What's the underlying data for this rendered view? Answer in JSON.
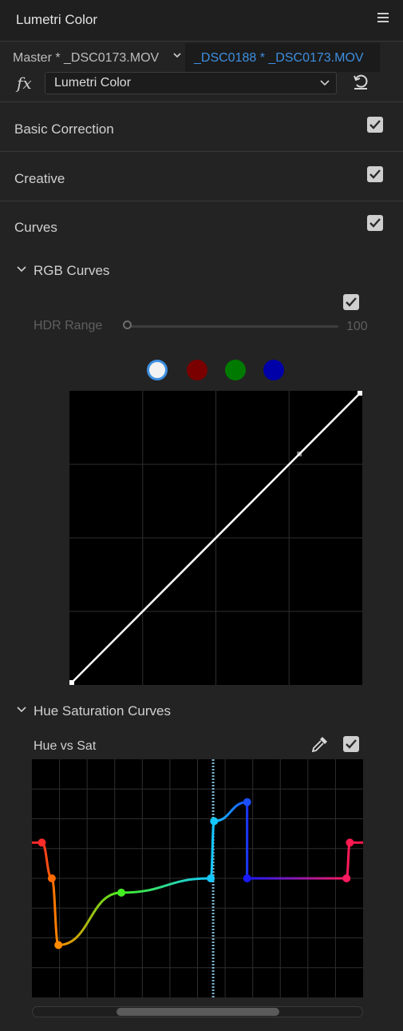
{
  "panel": {
    "title": "Lumetri Color"
  },
  "clip_bar": {
    "master_label": "Master * _DSC0173.MOV",
    "active_clip_label": "_DSC0188 * _DSC0173.MOV"
  },
  "effect": {
    "fx_symbol": "fx",
    "selected": "Lumetri Color"
  },
  "sections": {
    "basic_correction": {
      "label": "Basic Correction",
      "checked": true
    },
    "creative": {
      "label": "Creative",
      "checked": true
    },
    "curves": {
      "label": "Curves",
      "checked": true
    }
  },
  "rgb_curves": {
    "label": "RGB Curves",
    "enabled": true,
    "hdr_range": {
      "label": "HDR Range",
      "value": "100",
      "level": 0
    },
    "channels": [
      {
        "name": "white",
        "color": "#f2f2f2",
        "selected": true
      },
      {
        "name": "red",
        "color": "#7a0000",
        "selected": false
      },
      {
        "name": "green",
        "color": "#007a00",
        "selected": false
      },
      {
        "name": "blue",
        "color": "#0000a8",
        "selected": false
      }
    ],
    "curve_points": [
      [
        0,
        0
      ],
      [
        0.79,
        0.79
      ],
      [
        1,
        1
      ]
    ]
  },
  "hue_saturation_curves": {
    "label": "Hue Saturation Curves",
    "hue_vs_sat": {
      "label": "Hue vs Sat",
      "enabled": true
    },
    "points": [
      {
        "hue": 0.03,
        "sat": 0.65,
        "color": "#ff2a2a"
      },
      {
        "hue": 0.06,
        "sat": 0.5,
        "color": "#ff6a00"
      },
      {
        "hue": 0.08,
        "sat": 0.22,
        "color": "#ff8a00"
      },
      {
        "hue": 0.27,
        "sat": 0.44,
        "color": "#44ee22"
      },
      {
        "hue": 0.54,
        "sat": 0.5,
        "color": "#14c8ff"
      },
      {
        "hue": 0.55,
        "sat": 0.74,
        "color": "#14c8ff"
      },
      {
        "hue": 0.65,
        "sat": 0.82,
        "color": "#1a4dff"
      },
      {
        "hue": 0.65,
        "sat": 0.5,
        "color": "#1a1aff"
      },
      {
        "hue": 0.95,
        "sat": 0.5,
        "color": "#ff1a60"
      },
      {
        "hue": 0.96,
        "sat": 0.65,
        "color": "#ff1a50"
      }
    ],
    "scroll_position": 0.26
  },
  "icons": {
    "menu": "hamburger-icon",
    "reset": "reset-icon",
    "eyedropper": "eyedropper-icon",
    "chevron": "chevron-down-icon"
  },
  "colors": {
    "accent": "#3d8fe0",
    "panel_bg": "#232323",
    "graph_bg": "#000000"
  }
}
